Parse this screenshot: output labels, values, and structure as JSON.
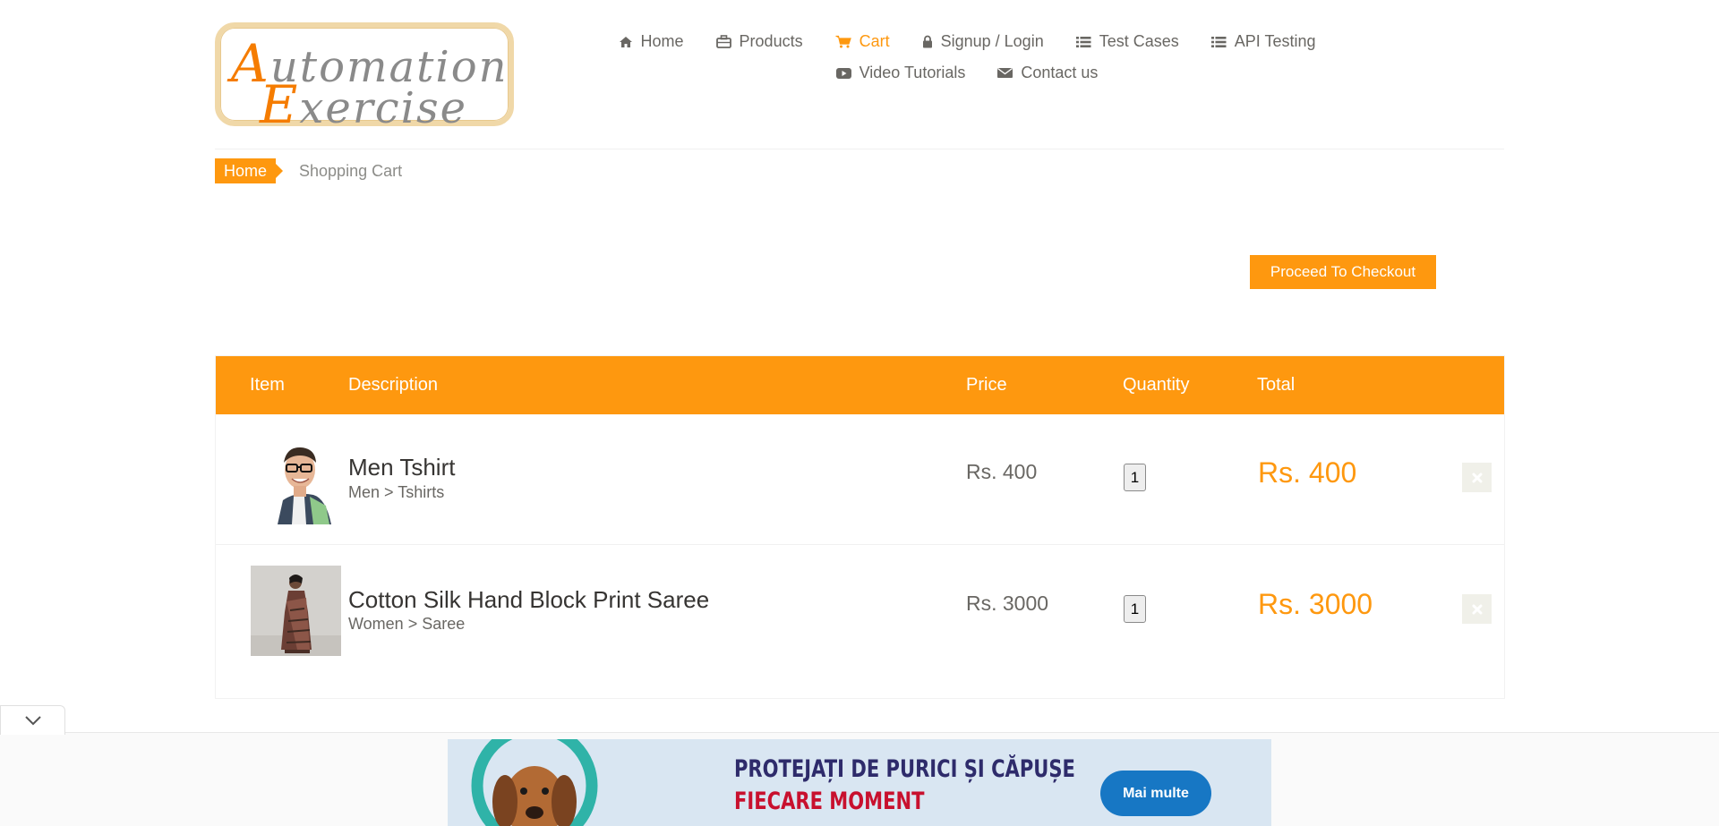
{
  "logo": {
    "line1": "utomation",
    "line1_cap": "A",
    "line2": "xercise",
    "line2_cap": "E"
  },
  "nav": {
    "items": [
      {
        "label": "Home",
        "icon": "home-icon"
      },
      {
        "label": "Products",
        "icon": "briefcase-icon"
      },
      {
        "label": "Cart",
        "icon": "shopping-cart-icon",
        "active": true
      },
      {
        "label": "Signup / Login",
        "icon": "lock-icon"
      },
      {
        "label": "Test Cases",
        "icon": "list-icon"
      },
      {
        "label": "API Testing",
        "icon": "list-icon"
      },
      {
        "label": "Video Tutorials",
        "icon": "youtube-play-icon"
      },
      {
        "label": "Contact us",
        "icon": "envelope-icon"
      }
    ]
  },
  "breadcrumb": {
    "home": "Home",
    "current": "Shopping Cart"
  },
  "checkout_label": "Proceed To Checkout",
  "cart": {
    "headers": {
      "item": "Item",
      "description": "Description",
      "price": "Price",
      "quantity": "Quantity",
      "total": "Total"
    },
    "rows": [
      {
        "name": "Men Tshirt",
        "category": "Men > Tshirts",
        "price": "Rs. 400",
        "quantity": "1",
        "total": "Rs. 400"
      },
      {
        "name": "Cotton Silk Hand Block Print Saree",
        "category": "Women > Saree",
        "price": "Rs. 3000",
        "quantity": "1",
        "total": "Rs. 3000"
      }
    ]
  },
  "ad": {
    "line1": "PROTEJAȚI DE PURICI ȘI CĂPUȘE",
    "line2": "FIECARE MOMENT",
    "button": "Mai multe"
  },
  "colors": {
    "accent": "#fe980f",
    "text": "#696763",
    "ad_bg": "#d9e6f2",
    "ad_button": "#1777c4"
  }
}
